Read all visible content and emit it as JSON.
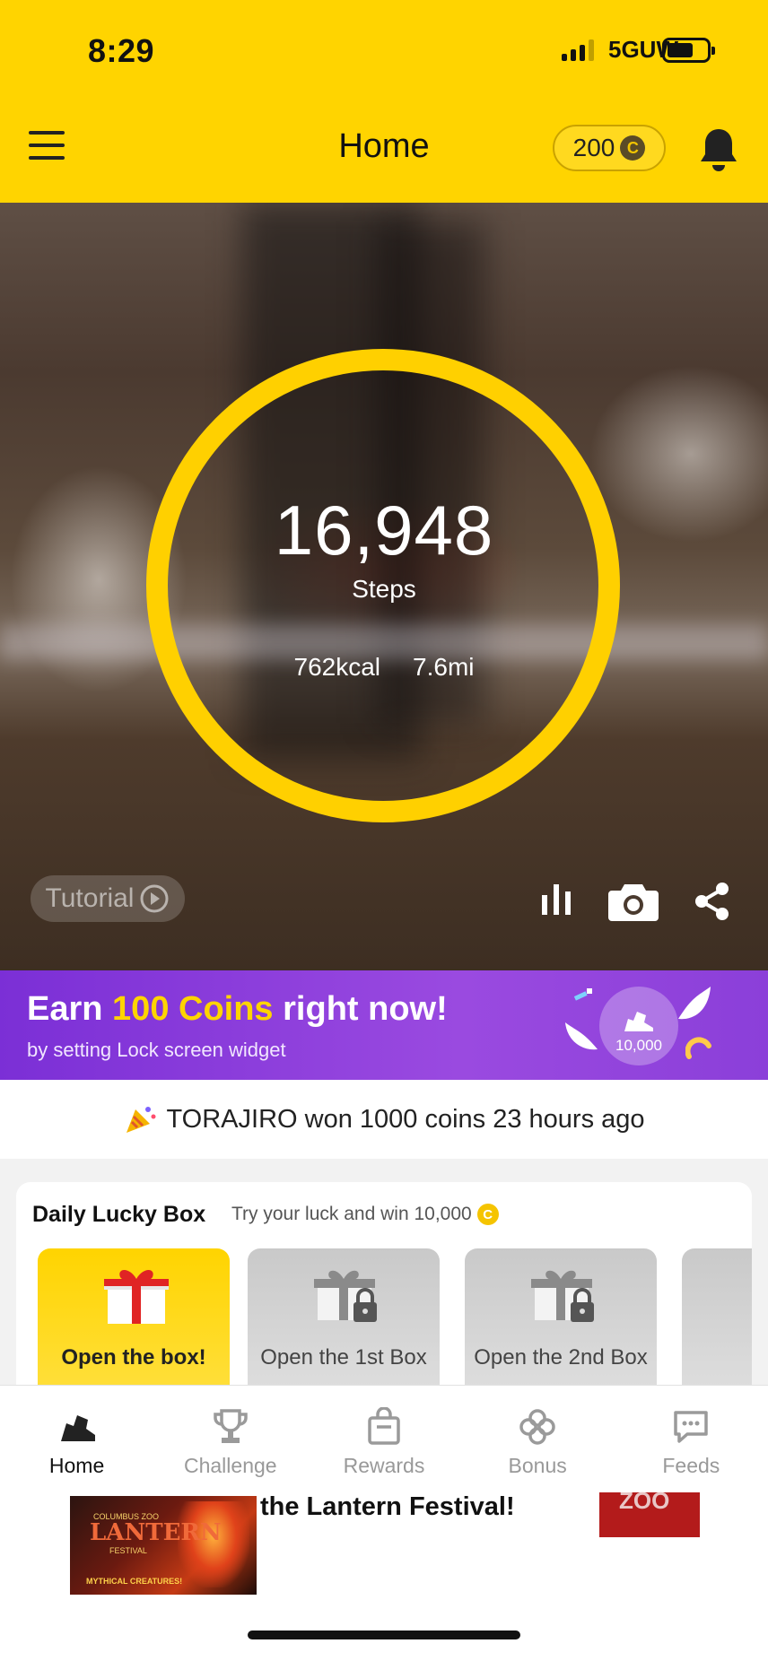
{
  "status_bar": {
    "time": "8:29",
    "network": "5GUW"
  },
  "header": {
    "title": "Home",
    "coins": "200",
    "coin_symbol": "C"
  },
  "hero": {
    "steps": "16,948",
    "steps_label": "Steps",
    "kcal": "762kcal",
    "distance": "7.6mi",
    "tutorial_label": "Tutorial"
  },
  "promo": {
    "title_pre": "Earn ",
    "title_highlight": "100 Coins",
    "title_post": " right now!",
    "subtitle": "by setting Lock screen widget",
    "badge_number": "10,000"
  },
  "ticker": {
    "text": "TORAJIRO won 1000 coins 23 hours ago"
  },
  "lucky_box": {
    "title": "Daily Lucky Box",
    "subtitle": "Try your luck and win 10,000",
    "coin_symbol": "C",
    "boxes": [
      {
        "label": "Open the box!"
      },
      {
        "label": "Open the 1st Box"
      },
      {
        "label": "Open the 2nd Box"
      }
    ]
  },
  "nav": [
    {
      "label": "Home",
      "icon": "shoe-icon"
    },
    {
      "label": "Challenge",
      "icon": "trophy-icon"
    },
    {
      "label": "Rewards",
      "icon": "shopping-bag-icon"
    },
    {
      "label": "Bonus",
      "icon": "clover-icon"
    },
    {
      "label": "Feeds",
      "icon": "chat-bubble-icon"
    }
  ],
  "ad": {
    "text": "the Lantern Festival!",
    "image_lines": [
      "COLUMBUS ZOO",
      "LANTERN",
      "FESTIVAL",
      "MYTHICAL CREATURES!"
    ],
    "logo_text": "ZOO"
  },
  "colors": {
    "brand_yellow": "#FFD400",
    "promo_purple": "#8b3fd9",
    "ring_yellow": "#FFD000"
  }
}
